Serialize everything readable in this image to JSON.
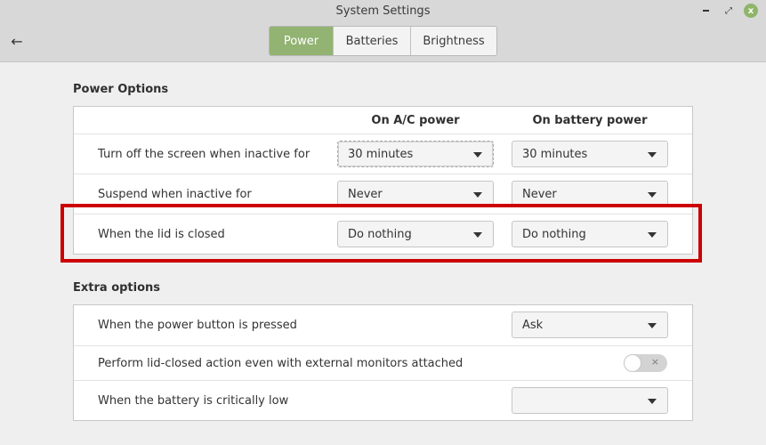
{
  "window": {
    "title": "System Settings",
    "controls": {
      "minimize": "minimize",
      "maximize": "maximize",
      "close": "x"
    }
  },
  "nav": {
    "back_icon": "←"
  },
  "tabs": [
    {
      "label": "Power",
      "active": true
    },
    {
      "label": "Batteries",
      "active": false
    },
    {
      "label": "Brightness",
      "active": false
    }
  ],
  "power_options": {
    "title": "Power Options",
    "columns": [
      "On A/C power",
      "On battery power"
    ],
    "rows": [
      {
        "label": "Turn off the screen when inactive for",
        "ac": "30 minutes",
        "battery": "30 minutes"
      },
      {
        "label": "Suspend when inactive for",
        "ac": "Never",
        "battery": "Never"
      },
      {
        "label": "When the lid is closed",
        "ac": "Do nothing",
        "battery": "Do nothing"
      }
    ]
  },
  "extra_options": {
    "title": "Extra options",
    "rows": [
      {
        "label": "When the power button is pressed",
        "value": "Ask"
      },
      {
        "label": "Perform lid-closed action even with external monitors attached",
        "toggle": false,
        "toggle_glyph": "×"
      },
      {
        "label": "When the battery is critically low",
        "value": ""
      }
    ]
  },
  "annotation": {
    "highlight_color": "#cc0000",
    "highlighted_row": "When the lid is closed"
  },
  "colors": {
    "accent": "#92b372",
    "titlebar": "#d8d8d8",
    "background": "#efefef"
  }
}
